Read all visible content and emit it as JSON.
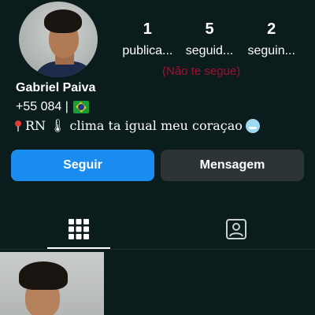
{
  "profile": {
    "name": "Gabriel Paiva",
    "bio_line1": "+55 084 |",
    "bio_line2": "RN 🌡 clima ta igual meu coraçao"
  },
  "stats": [
    {
      "value": "1",
      "label": "publica..."
    },
    {
      "value": "5",
      "label": "seguid..."
    },
    {
      "value": "2",
      "label": "seguin..."
    }
  ],
  "relationship_note": "(Não te segue)",
  "buttons": {
    "follow": "Seguir",
    "message": "Mensagem"
  },
  "tabs": {
    "grid_icon": "grid-icon",
    "tagged_icon": "tagged-person-icon",
    "active": "grid"
  },
  "colors": {
    "background": "#0b1c1c",
    "follow_button": "#1a8cf0",
    "message_button": "#2d3438",
    "not_following_text": "#a01030"
  }
}
